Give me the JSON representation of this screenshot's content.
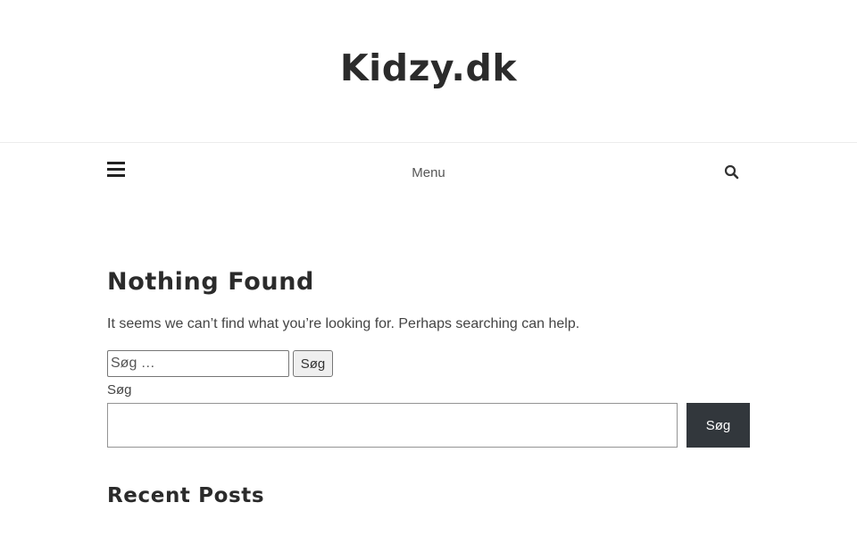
{
  "header": {
    "site_title": "Kidzy.dk"
  },
  "nav": {
    "menu_label": "Menu"
  },
  "main": {
    "title": "Nothing Found",
    "message": "It seems we can’t find what you’re looking for. Perhaps searching can help.",
    "search_form": {
      "placeholder": "Søg …",
      "button_label": "Søg"
    },
    "search_block": {
      "label": "Søg",
      "value": "",
      "button_label": "Søg"
    },
    "recent_posts_title": "Recent Posts"
  },
  "icons": {
    "menu": "hamburger-icon",
    "search": "search-icon"
  }
}
